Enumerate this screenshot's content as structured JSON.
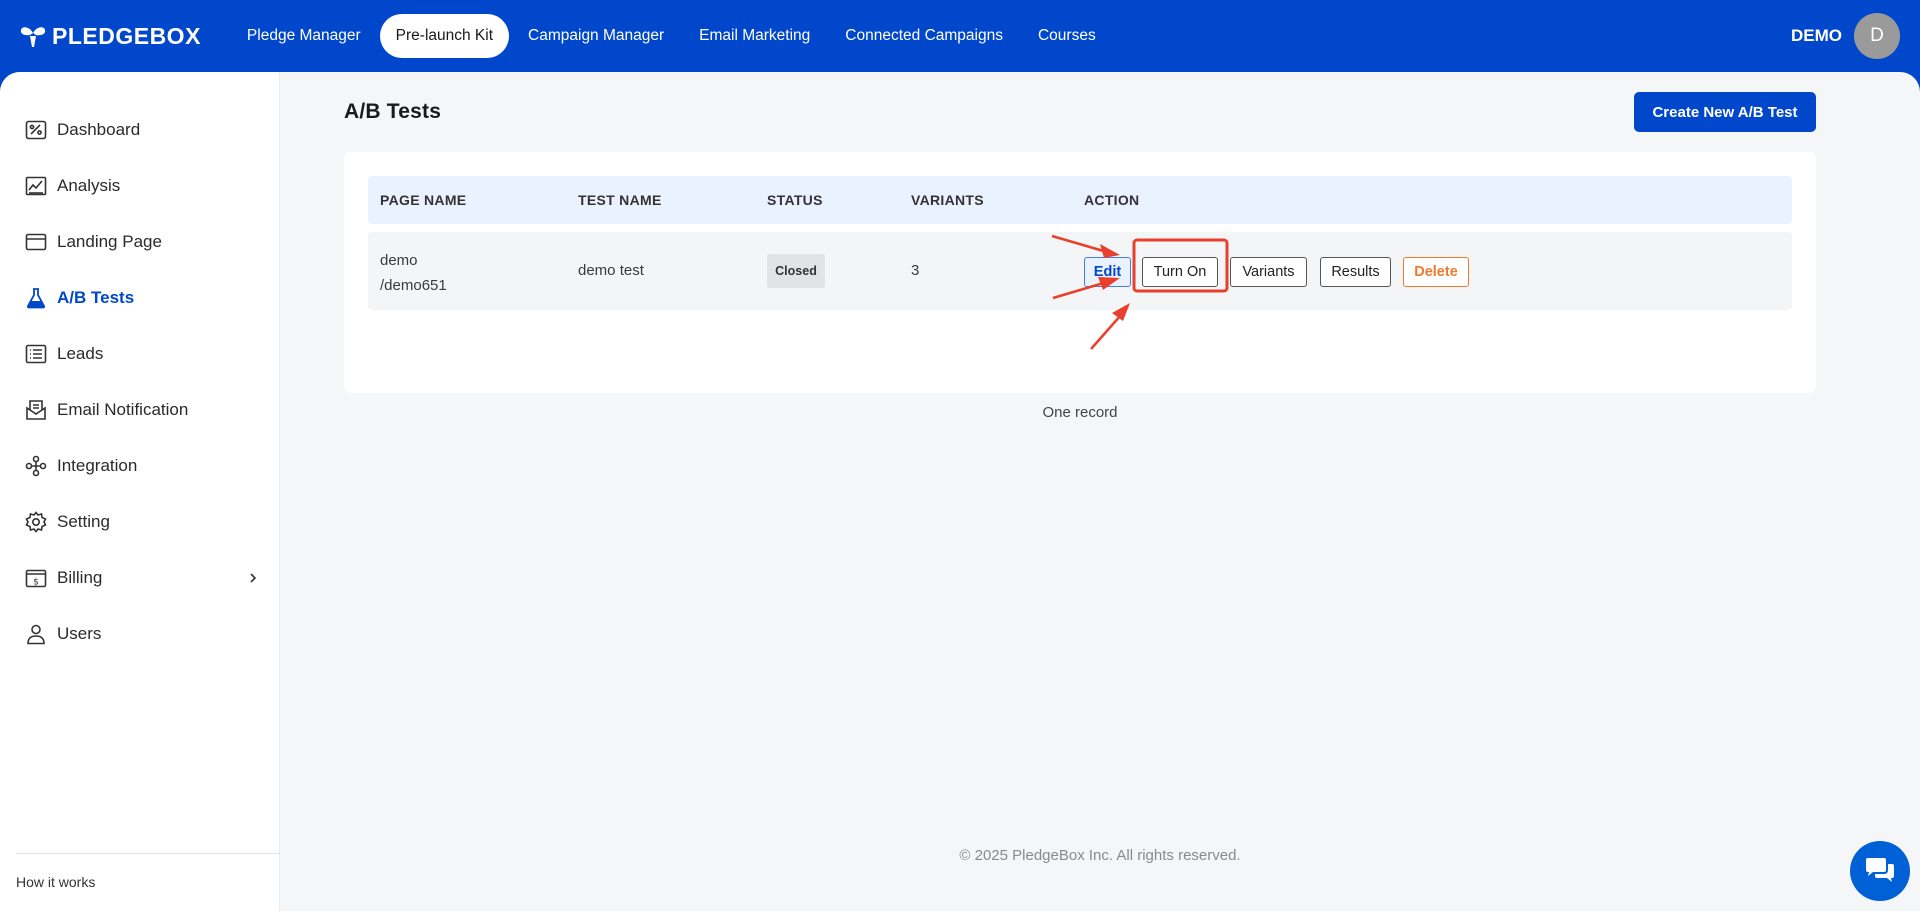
{
  "brand": {
    "name": "PLEDGEBOX"
  },
  "nav": {
    "items": [
      {
        "label": "Pledge Manager",
        "active": false
      },
      {
        "label": "Pre-launch Kit",
        "active": true
      },
      {
        "label": "Campaign Manager",
        "active": false
      },
      {
        "label": "Email Marketing",
        "active": false
      },
      {
        "label": "Connected Campaigns",
        "active": false
      },
      {
        "label": "Courses",
        "active": false
      }
    ]
  },
  "user": {
    "name": "DEMO",
    "initial": "D"
  },
  "sidebar": {
    "items": [
      {
        "label": "Dashboard",
        "icon": "dashboard-icon"
      },
      {
        "label": "Analysis",
        "icon": "analysis-icon"
      },
      {
        "label": "Landing Page",
        "icon": "landing-page-icon"
      },
      {
        "label": "A/B Tests",
        "icon": "flask-icon",
        "active": true
      },
      {
        "label": "Leads",
        "icon": "leads-icon"
      },
      {
        "label": "Email Notification",
        "icon": "email-notification-icon"
      },
      {
        "label": "Integration",
        "icon": "integration-icon"
      },
      {
        "label": "Setting",
        "icon": "gear-icon"
      },
      {
        "label": "Billing",
        "icon": "billing-icon"
      },
      {
        "label": "Users",
        "icon": "user-icon"
      }
    ],
    "how_it_works": "How it works"
  },
  "main": {
    "title": "A/B Tests",
    "create_button": "Create New A/B Test",
    "table": {
      "headers": [
        "PAGE NAME",
        "TEST NAME",
        "STATUS",
        "VARIANTS",
        "ACTION"
      ],
      "rows": [
        {
          "page_name_line1": "demo",
          "page_name_line2": "/demo651",
          "test_name": "demo test",
          "status": "Closed",
          "variants": "3",
          "actions": {
            "edit": "Edit",
            "turn_on": "Turn On",
            "variants": "Variants",
            "results": "Results",
            "delete": "Delete"
          }
        }
      ]
    },
    "record_count": "One record"
  },
  "footer": {
    "text": "© 2025 PledgeBox Inc. All rights reserved."
  },
  "colors": {
    "brand": "#0047cc",
    "delete": "#f07a2c",
    "annotation": "#e8402a"
  }
}
